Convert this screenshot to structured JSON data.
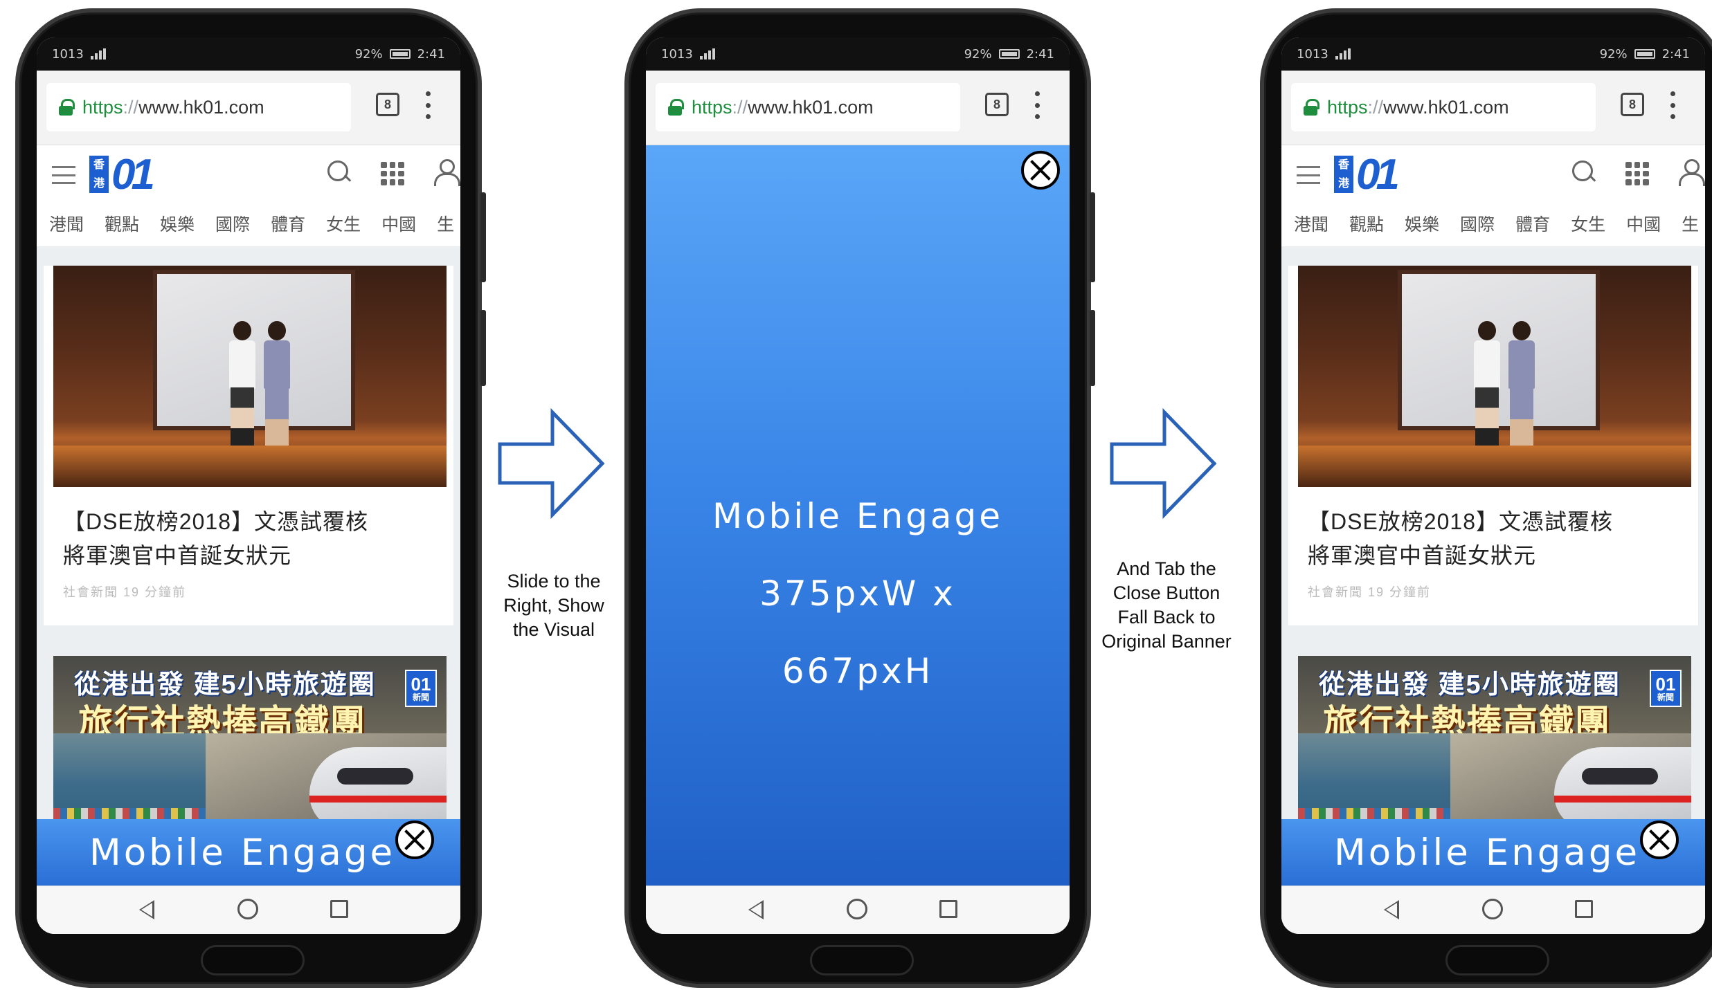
{
  "status_bar": {
    "carrier": "1013",
    "battery": "92%",
    "time": "2:41"
  },
  "browser": {
    "url_scheme": "https",
    "url_sep": "://",
    "url_host": "www.hk01.com",
    "tab_count": "8"
  },
  "site": {
    "logo_chars": [
      "香",
      "港"
    ],
    "logo_text": "01",
    "categories": [
      "港聞",
      "觀點",
      "娛樂",
      "國際",
      "體育",
      "女生",
      "中國",
      "生"
    ]
  },
  "article": {
    "headline_line1": "【DSE放榜2018】文憑試覆核",
    "headline_line2": "將軍澳官中首誕女狀元",
    "meta": "社會新聞 19 分鐘前"
  },
  "promo": {
    "line1": "從港出發 建5小時旅遊圈",
    "line2": "旅行社熱捧高鐵團",
    "badge": "01",
    "badge_sub": "新聞"
  },
  "banner": {
    "label": "Mobile Engage"
  },
  "overlay": {
    "line1": "Mobile Engage",
    "line2": "375pxW x",
    "line3": "667pxH"
  },
  "steps": {
    "caption_1": [
      "Slide to the",
      "Right, Show",
      "the Visual"
    ],
    "caption_2": [
      "And Tab the",
      "Close Button",
      "Fall Back to",
      "Original Banner"
    ]
  },
  "colors": {
    "banner_blue": "#2a6fd6",
    "overlay_blue_top": "#5aa6f8",
    "overlay_blue_bottom": "#1f5fc6",
    "arrow_stroke": "#2a62b8",
    "https_green": "#1e8e3e"
  }
}
